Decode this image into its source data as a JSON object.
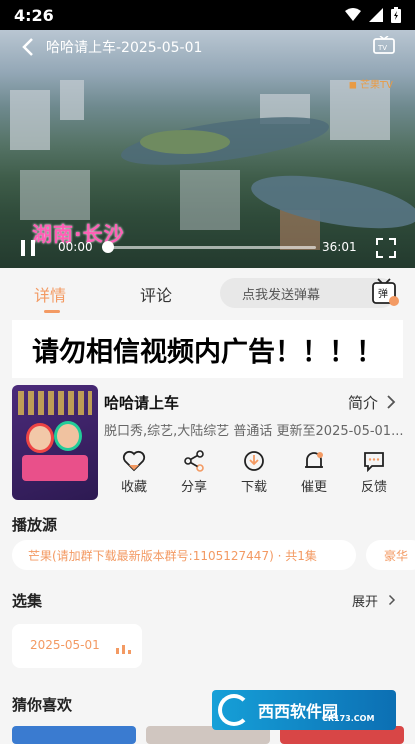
{
  "status": {
    "time": "4:26"
  },
  "player": {
    "title": "哈哈请上车-2025-05-01",
    "location_caption": "湖南·长沙",
    "elapsed": "00:00",
    "duration": "36:01",
    "progress": 0.0
  },
  "tabs": {
    "details": "详情",
    "comments": "评论"
  },
  "danmu": {
    "placeholder": "点我发送弹幕",
    "icon_label": "弹"
  },
  "banner": {
    "text": "请勿相信视频内广告！！！！"
  },
  "show": {
    "title": "哈哈请上车",
    "intro_label": "简介",
    "meta": "脱口秀,综艺,大陆综艺 普通话 更新至2025-05-01..."
  },
  "actions": [
    {
      "label": "收藏",
      "icon": "heart-icon"
    },
    {
      "label": "分享",
      "icon": "share-icon"
    },
    {
      "label": "下载",
      "icon": "download-icon"
    },
    {
      "label": "催更",
      "icon": "bell-icon"
    },
    {
      "label": "反馈",
      "icon": "feedback-icon"
    }
  ],
  "source": {
    "heading": "播放源",
    "options": [
      "芒果(请加群下载最新版本群号:1105127447) · 共1集",
      "豪华"
    ]
  },
  "episodes": {
    "heading": "选集",
    "expand_label": "展开",
    "items": [
      "2025-05-01"
    ]
  },
  "recommend": {
    "heading": "猜你喜欢"
  },
  "watermark": {
    "text": "西西软件园",
    "sub": "CR173.COM"
  },
  "colors": {
    "accent": "#f39a63",
    "background": "#f5f5f5"
  }
}
